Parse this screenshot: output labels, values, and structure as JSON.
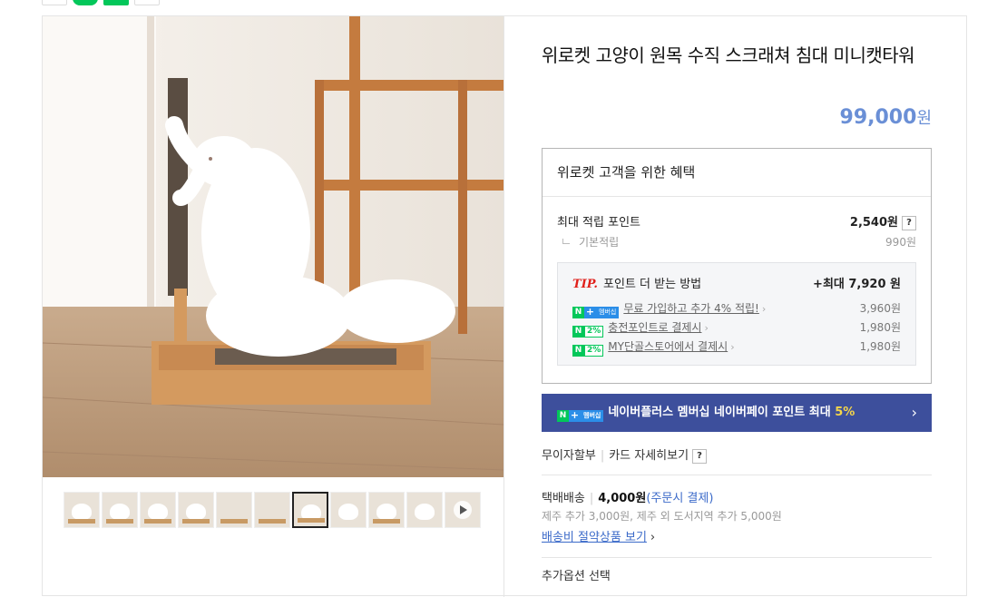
{
  "product": {
    "title": "위로켓 고양이 원목 수직 스크래쳐 침대 미니캣타워",
    "price": "99,000",
    "price_unit": "원"
  },
  "benefit": {
    "heading": "위로켓 고객을 위한 혜택",
    "max_points_label": "최대 적립 포인트",
    "max_points_value": "2,540원",
    "help_glyph": "?",
    "base_label": "기본적립",
    "base_value": "990원",
    "tip": {
      "tip_mark": "TIP.",
      "heading": "포인트 더 받는 방법",
      "max_value": "+최대 7,920 원",
      "rows": [
        {
          "badge_n": "N",
          "badge_plus": "+",
          "badge_text": "멤버십",
          "label": "무료 가입하고 추가 4% 적립!",
          "value": "3,960원"
        },
        {
          "badge_n": "N",
          "badge_text": "2%",
          "label": "충전포인트로 결제시",
          "value": "1,980원"
        },
        {
          "badge_n": "N",
          "badge_text": "2%",
          "label": "MY단골스토어에서 결제시",
          "value": "1,980원"
        }
      ]
    }
  },
  "plus_banner": {
    "badge_n": "N",
    "badge_plus": "+",
    "badge_text": "멤버십",
    "text": "네이버플러스 멤버십 네이버페이 포인트 최대 ",
    "highlight": "5%",
    "chevron": "›"
  },
  "card": {
    "installment": "무이자할부",
    "details": "카드 자세히보기",
    "help_glyph": "?"
  },
  "shipping": {
    "label": "택배배송",
    "fee": "4,000원",
    "payment": "(주문시 결제)",
    "extra": "제주 추가 3,000원, 제주 외 도서지역 추가 5,000원",
    "link": "배송비 절약상품 보기",
    "link_arrow": "›"
  },
  "next_section_label": "추가옵션 선택",
  "thumbnails": [
    "thumb-1",
    "thumb-2",
    "thumb-3",
    "thumb-4",
    "thumb-5",
    "thumb-6",
    "thumb-7",
    "thumb-8",
    "thumb-9",
    "thumb-10",
    "thumb-11"
  ]
}
